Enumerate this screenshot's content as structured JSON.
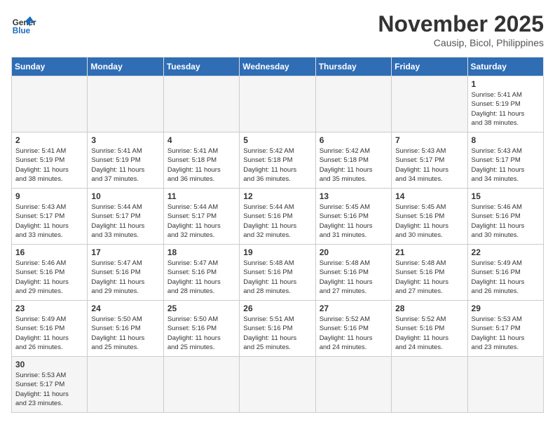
{
  "header": {
    "logo_general": "General",
    "logo_blue": "Blue",
    "month_title": "November 2025",
    "location": "Causip, Bicol, Philippines"
  },
  "weekdays": [
    "Sunday",
    "Monday",
    "Tuesday",
    "Wednesday",
    "Thursday",
    "Friday",
    "Saturday"
  ],
  "weeks": [
    [
      {
        "day": "",
        "info": ""
      },
      {
        "day": "",
        "info": ""
      },
      {
        "day": "",
        "info": ""
      },
      {
        "day": "",
        "info": ""
      },
      {
        "day": "",
        "info": ""
      },
      {
        "day": "",
        "info": ""
      },
      {
        "day": "1",
        "info": "Sunrise: 5:41 AM\nSunset: 5:19 PM\nDaylight: 11 hours\nand 38 minutes."
      }
    ],
    [
      {
        "day": "2",
        "info": "Sunrise: 5:41 AM\nSunset: 5:19 PM\nDaylight: 11 hours\nand 38 minutes."
      },
      {
        "day": "3",
        "info": "Sunrise: 5:41 AM\nSunset: 5:19 PM\nDaylight: 11 hours\nand 37 minutes."
      },
      {
        "day": "4",
        "info": "Sunrise: 5:41 AM\nSunset: 5:18 PM\nDaylight: 11 hours\nand 36 minutes."
      },
      {
        "day": "5",
        "info": "Sunrise: 5:42 AM\nSunset: 5:18 PM\nDaylight: 11 hours\nand 36 minutes."
      },
      {
        "day": "6",
        "info": "Sunrise: 5:42 AM\nSunset: 5:18 PM\nDaylight: 11 hours\nand 35 minutes."
      },
      {
        "day": "7",
        "info": "Sunrise: 5:43 AM\nSunset: 5:17 PM\nDaylight: 11 hours\nand 34 minutes."
      },
      {
        "day": "8",
        "info": "Sunrise: 5:43 AM\nSunset: 5:17 PM\nDaylight: 11 hours\nand 34 minutes."
      }
    ],
    [
      {
        "day": "9",
        "info": "Sunrise: 5:43 AM\nSunset: 5:17 PM\nDaylight: 11 hours\nand 33 minutes."
      },
      {
        "day": "10",
        "info": "Sunrise: 5:44 AM\nSunset: 5:17 PM\nDaylight: 11 hours\nand 33 minutes."
      },
      {
        "day": "11",
        "info": "Sunrise: 5:44 AM\nSunset: 5:17 PM\nDaylight: 11 hours\nand 32 minutes."
      },
      {
        "day": "12",
        "info": "Sunrise: 5:44 AM\nSunset: 5:16 PM\nDaylight: 11 hours\nand 32 minutes."
      },
      {
        "day": "13",
        "info": "Sunrise: 5:45 AM\nSunset: 5:16 PM\nDaylight: 11 hours\nand 31 minutes."
      },
      {
        "day": "14",
        "info": "Sunrise: 5:45 AM\nSunset: 5:16 PM\nDaylight: 11 hours\nand 30 minutes."
      },
      {
        "day": "15",
        "info": "Sunrise: 5:46 AM\nSunset: 5:16 PM\nDaylight: 11 hours\nand 30 minutes."
      }
    ],
    [
      {
        "day": "16",
        "info": "Sunrise: 5:46 AM\nSunset: 5:16 PM\nDaylight: 11 hours\nand 29 minutes."
      },
      {
        "day": "17",
        "info": "Sunrise: 5:47 AM\nSunset: 5:16 PM\nDaylight: 11 hours\nand 29 minutes."
      },
      {
        "day": "18",
        "info": "Sunrise: 5:47 AM\nSunset: 5:16 PM\nDaylight: 11 hours\nand 28 minutes."
      },
      {
        "day": "19",
        "info": "Sunrise: 5:48 AM\nSunset: 5:16 PM\nDaylight: 11 hours\nand 28 minutes."
      },
      {
        "day": "20",
        "info": "Sunrise: 5:48 AM\nSunset: 5:16 PM\nDaylight: 11 hours\nand 27 minutes."
      },
      {
        "day": "21",
        "info": "Sunrise: 5:48 AM\nSunset: 5:16 PM\nDaylight: 11 hours\nand 27 minutes."
      },
      {
        "day": "22",
        "info": "Sunrise: 5:49 AM\nSunset: 5:16 PM\nDaylight: 11 hours\nand 26 minutes."
      }
    ],
    [
      {
        "day": "23",
        "info": "Sunrise: 5:49 AM\nSunset: 5:16 PM\nDaylight: 11 hours\nand 26 minutes."
      },
      {
        "day": "24",
        "info": "Sunrise: 5:50 AM\nSunset: 5:16 PM\nDaylight: 11 hours\nand 25 minutes."
      },
      {
        "day": "25",
        "info": "Sunrise: 5:50 AM\nSunset: 5:16 PM\nDaylight: 11 hours\nand 25 minutes."
      },
      {
        "day": "26",
        "info": "Sunrise: 5:51 AM\nSunset: 5:16 PM\nDaylight: 11 hours\nand 25 minutes."
      },
      {
        "day": "27",
        "info": "Sunrise: 5:52 AM\nSunset: 5:16 PM\nDaylight: 11 hours\nand 24 minutes."
      },
      {
        "day": "28",
        "info": "Sunrise: 5:52 AM\nSunset: 5:16 PM\nDaylight: 11 hours\nand 24 minutes."
      },
      {
        "day": "29",
        "info": "Sunrise: 5:53 AM\nSunset: 5:17 PM\nDaylight: 11 hours\nand 23 minutes."
      }
    ],
    [
      {
        "day": "30",
        "info": "Sunrise: 5:53 AM\nSunset: 5:17 PM\nDaylight: 11 hours\nand 23 minutes."
      },
      {
        "day": "",
        "info": ""
      },
      {
        "day": "",
        "info": ""
      },
      {
        "day": "",
        "info": ""
      },
      {
        "day": "",
        "info": ""
      },
      {
        "day": "",
        "info": ""
      },
      {
        "day": "",
        "info": ""
      }
    ]
  ]
}
